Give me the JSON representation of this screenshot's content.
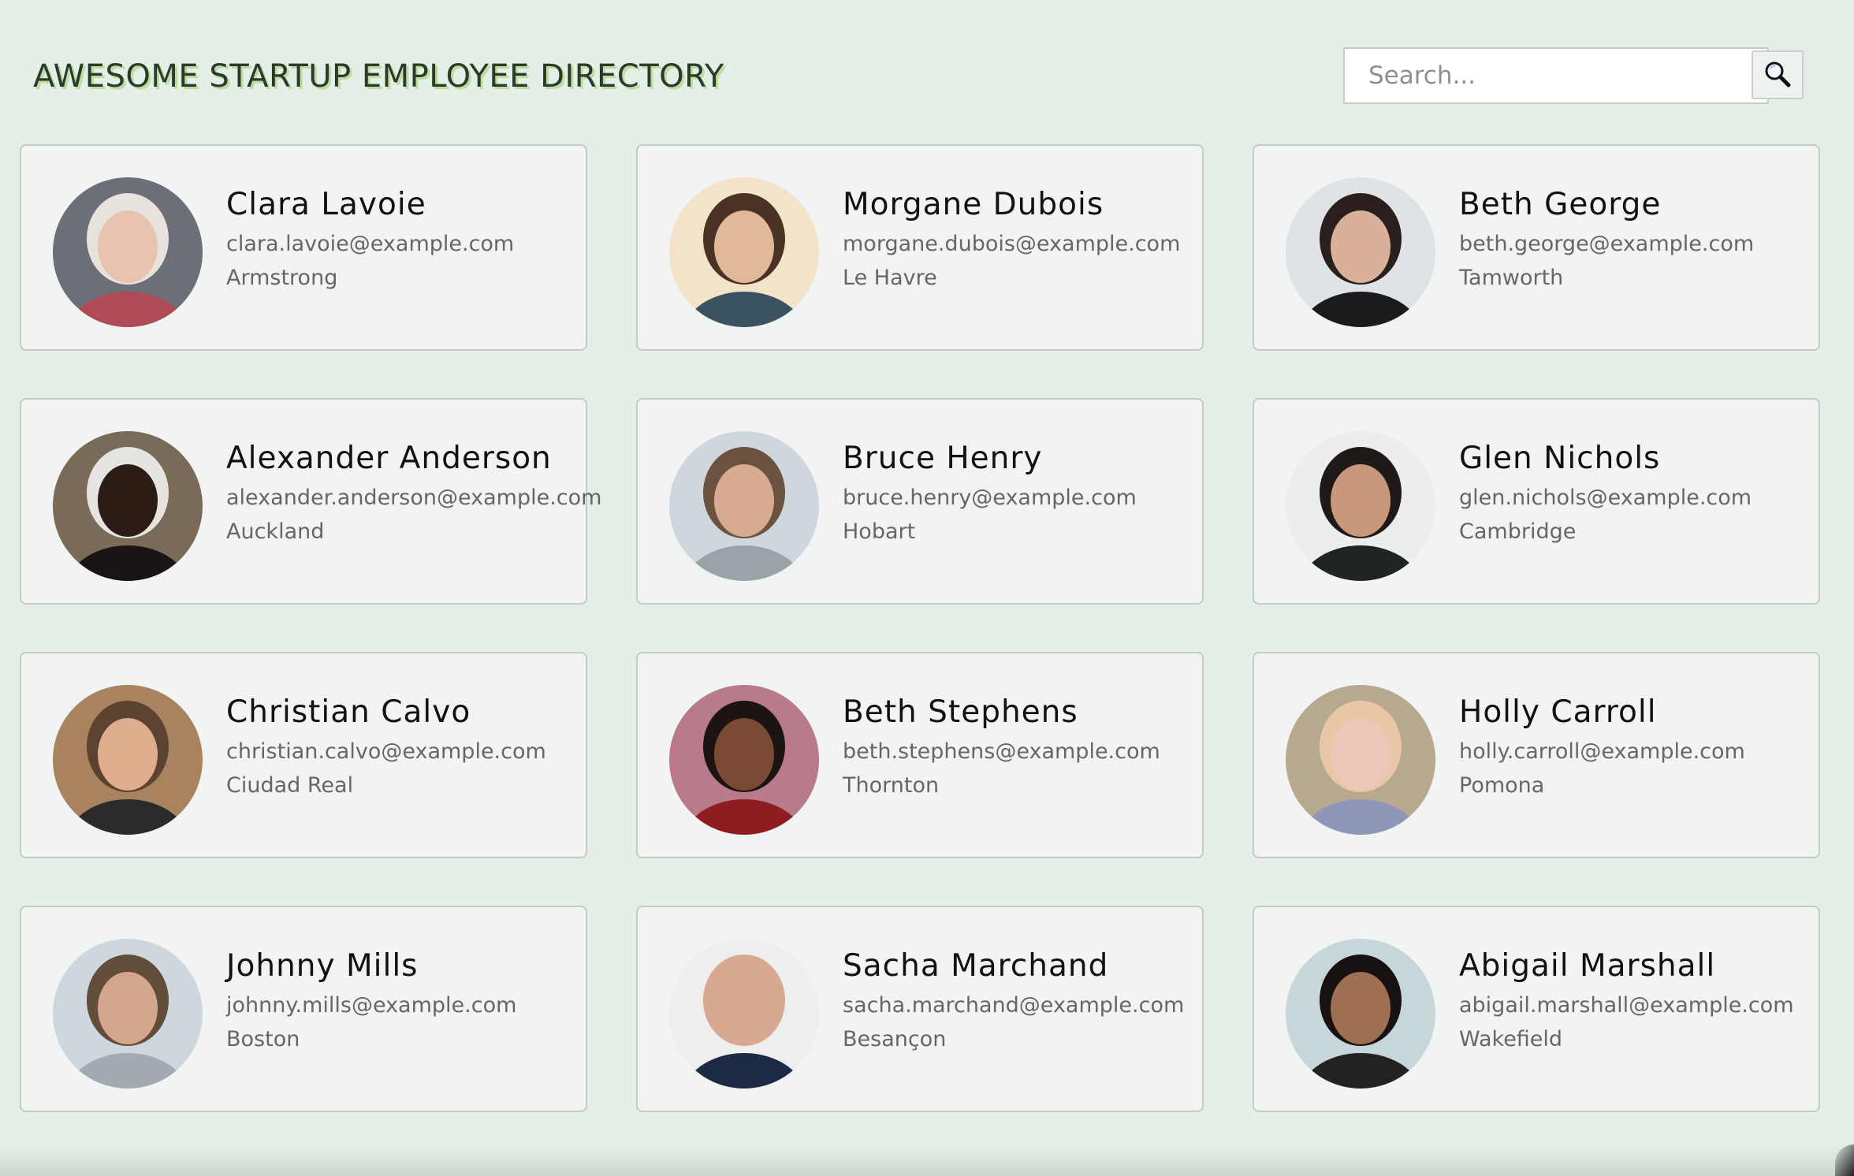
{
  "header": {
    "title": "AWESOME STARTUP EMPLOYEE DIRECTORY",
    "search_placeholder": "Search...",
    "search_icon": "magnifier-icon"
  },
  "colors": {
    "background": "#e3efe7",
    "card_background": "#f2f4f3",
    "title_shadow": "#c0dc9c"
  },
  "employees": [
    {
      "name": "Clara Lavoie",
      "email": "clara.lavoie@example.com",
      "location": "Armstrong",
      "avatar_bg": "#6d6f78",
      "avatar_skin": "#e9c2b0",
      "avatar_hair": "#e7e3dc",
      "avatar_shirt": "#b04a55"
    },
    {
      "name": "Morgane Dubois",
      "email": "morgane.dubois@example.com",
      "location": "Le Havre",
      "avatar_bg": "#f3e3c8",
      "avatar_skin": "#e2b89b",
      "avatar_hair": "#4a3224",
      "avatar_shirt": "#3b5263"
    },
    {
      "name": "Beth George",
      "email": "beth.george@example.com",
      "location": "Tamworth",
      "avatar_bg": "#dfe3e6",
      "avatar_skin": "#d9b09a",
      "avatar_hair": "#2a1f1c",
      "avatar_shirt": "#1b1a1c"
    },
    {
      "name": "Alexander Anderson",
      "email": "alexander.anderson@example.com",
      "location": "Auckland",
      "avatar_bg": "#7a6a58",
      "avatar_skin": "#2b1c16",
      "avatar_hair": "#e6e4e0",
      "avatar_shirt": "#1a1514"
    },
    {
      "name": "Bruce Henry",
      "email": "bruce.henry@example.com",
      "location": "Hobart",
      "avatar_bg": "#cfd6dd",
      "avatar_skin": "#d7ab90",
      "avatar_hair": "#6b5340",
      "avatar_shirt": "#9aa3a8"
    },
    {
      "name": "Glen Nichols",
      "email": "glen.nichols@example.com",
      "location": "Cambridge",
      "avatar_bg": "#eceeee",
      "avatar_skin": "#c9977c",
      "avatar_hair": "#1f1a17",
      "avatar_shirt": "#1e2420"
    },
    {
      "name": "Christian Calvo",
      "email": "christian.calvo@example.com",
      "location": "Ciudad Real",
      "avatar_bg": "#a9835f",
      "avatar_skin": "#e0ad8e",
      "avatar_hair": "#5b4231",
      "avatar_shirt": "#2b2b2e"
    },
    {
      "name": "Beth Stephens",
      "email": "beth.stephens@example.com",
      "location": "Thornton",
      "avatar_bg": "#b97a8a",
      "avatar_skin": "#7a4a34",
      "avatar_hair": "#1c1412",
      "avatar_shirt": "#8d1d1f"
    },
    {
      "name": "Holly Carroll",
      "email": "holly.carroll@example.com",
      "location": "Pomona",
      "avatar_bg": "#b7a890",
      "avatar_skin": "#ecc6b6",
      "avatar_hair": "#e9c7a6",
      "avatar_shirt": "#8f97b8"
    },
    {
      "name": "Johnny Mills",
      "email": "johnny.mills@example.com",
      "location": "Boston",
      "avatar_bg": "#ced6de",
      "avatar_skin": "#d4a78c",
      "avatar_hair": "#624c3a",
      "avatar_shirt": "#a4abb0"
    },
    {
      "name": "Sacha Marchand",
      "email": "sacha.marchand@example.com",
      "location": "Besançon",
      "avatar_bg": "#eeeeee",
      "avatar_skin": "#d6a990",
      "avatar_hair": "#d6a990",
      "avatar_shirt": "#1d2a44"
    },
    {
      "name": "Abigail Marshall",
      "email": "abigail.marshall@example.com",
      "location": "Wakefield",
      "avatar_bg": "#c7d6d8",
      "avatar_skin": "#a06e52",
      "avatar_hair": "#171211",
      "avatar_shirt": "#222"
    }
  ]
}
